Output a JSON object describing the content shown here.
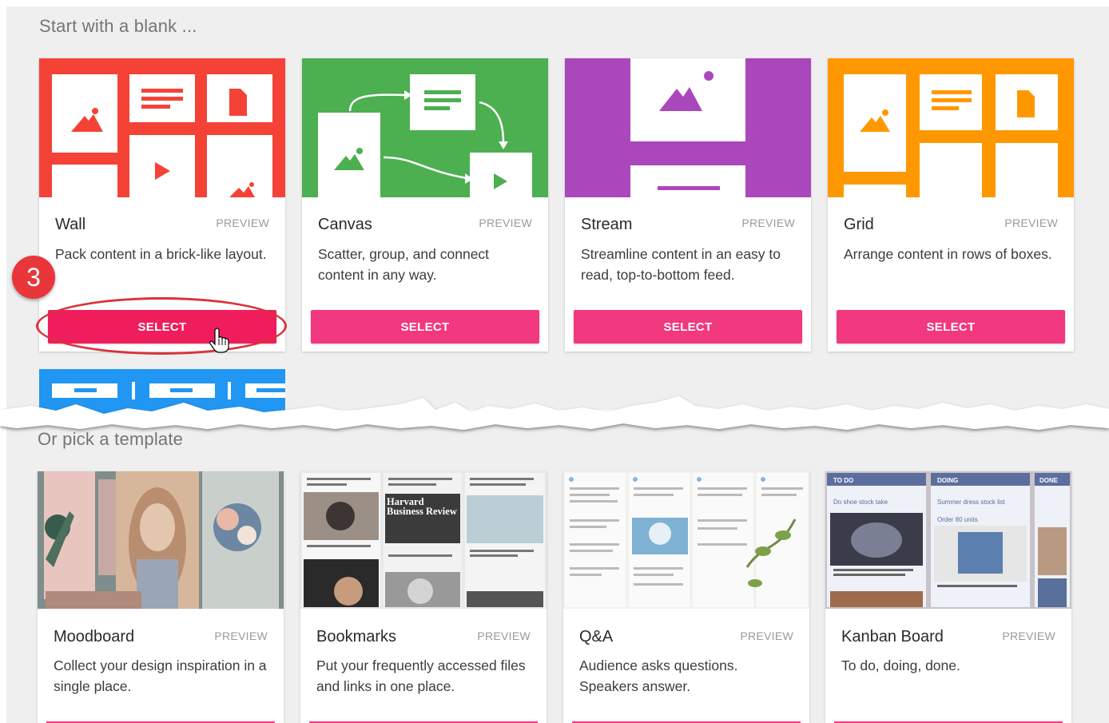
{
  "blank_section": {
    "heading": "Start with a blank ...",
    "cards": [
      {
        "title": "Wall",
        "preview": "PREVIEW",
        "desc": "Pack content in a brick-like layout.",
        "button": "SELECT",
        "color": "#f44336",
        "icon": "wall-layout-icon"
      },
      {
        "title": "Canvas",
        "preview": "PREVIEW",
        "desc": "Scatter, group, and connect content in any way.",
        "button": "SELECT",
        "color": "#4caf50",
        "icon": "canvas-layout-icon"
      },
      {
        "title": "Stream",
        "preview": "PREVIEW",
        "desc": "Streamline content in an easy to read, top-to-bottom feed.",
        "button": "SELECT",
        "color": "#ab47bc",
        "icon": "stream-layout-icon"
      },
      {
        "title": "Grid",
        "preview": "PREVIEW",
        "desc": "Arrange content in rows of boxes.",
        "button": "SELECT",
        "color": "#ff9800",
        "icon": "grid-layout-icon"
      }
    ]
  },
  "template_section": {
    "heading": "Or pick a template",
    "cards": [
      {
        "title": "Moodboard",
        "preview": "PREVIEW",
        "desc": "Collect your design inspiration in a single place.",
        "image": "moodboard-thumbnail"
      },
      {
        "title": "Bookmarks",
        "preview": "PREVIEW",
        "desc": "Put your frequently accessed files and links in one place.",
        "image": "bookmarks-thumbnail",
        "thumb_text": {
          "hbr": "Harvard Business Review"
        }
      },
      {
        "title": "Q&A",
        "preview": "PREVIEW",
        "desc": "Audience asks questions. Speakers answer.",
        "image": "qa-thumbnail"
      },
      {
        "title": "Kanban Board",
        "preview": "PREVIEW",
        "desc": "To do, doing, done.",
        "image": "kanban-thumbnail",
        "thumb_text": {
          "col1": "TO DO",
          "col2": "DOING",
          "col3": "DONE",
          "item1": "Do shoe stock take",
          "item2": "Summer dress stock list",
          "item3": "Order 80 units"
        }
      }
    ]
  },
  "annotation": {
    "step_number": "3"
  },
  "colors": {
    "accent": "#f2387f",
    "annotation_red": "#e8363b"
  }
}
